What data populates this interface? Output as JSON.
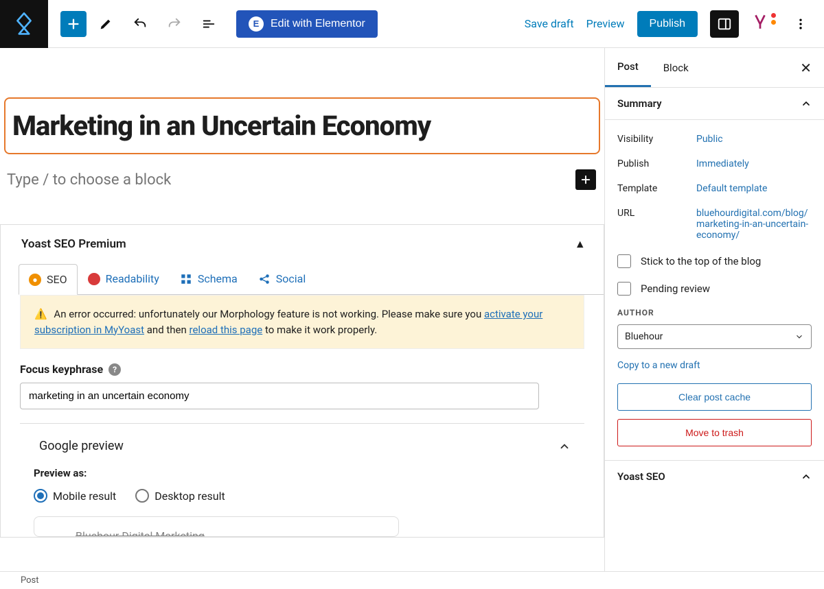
{
  "topbar": {
    "edit_with_label": "Edit with Elementor",
    "save_draft": "Save draft",
    "preview": "Preview",
    "publish": "Publish"
  },
  "editor": {
    "post_title": "Marketing in an Uncertain Economy",
    "block_placeholder": "Type / to choose a block"
  },
  "yoast": {
    "panel_title": "Yoast SEO Premium",
    "tabs": {
      "seo": "SEO",
      "readability": "Readability",
      "schema": "Schema",
      "social": "Social"
    },
    "alert_pre": "An error occurred: unfortunately our Morphology feature is not working. Please make sure you ",
    "alert_link1": "activate your subscription in MyYoast",
    "alert_mid": " and then ",
    "alert_link2": "reload this page",
    "alert_post": " to make it work properly.",
    "focus_label": "Focus keyphrase",
    "focus_value": "marketing in an uncertain economy",
    "google_preview": "Google preview",
    "preview_as": "Preview as:",
    "mobile_result": "Mobile result",
    "desktop_result": "Desktop result",
    "preview_site": "Bluehour Digital Marketing"
  },
  "sidebar": {
    "tabs": {
      "post": "Post",
      "block": "Block"
    },
    "summary": {
      "title": "Summary",
      "visibility_k": "Visibility",
      "visibility_v": "Public",
      "publish_k": "Publish",
      "publish_v": "Immediately",
      "template_k": "Template",
      "template_v": "Default template",
      "url_k": "URL",
      "url_v": "bluehourdigital.com/blog/marketing-in-an-uncertain-economy/",
      "stick": "Stick to the top of the blog",
      "pending": "Pending review",
      "author_label": "AUTHOR",
      "author_value": "Bluehour",
      "copy_draft": "Copy to a new draft",
      "clear_cache": "Clear post cache",
      "trash": "Move to trash"
    },
    "yoast_section": "Yoast SEO"
  },
  "bottombar": {
    "breadcrumb": "Post"
  }
}
